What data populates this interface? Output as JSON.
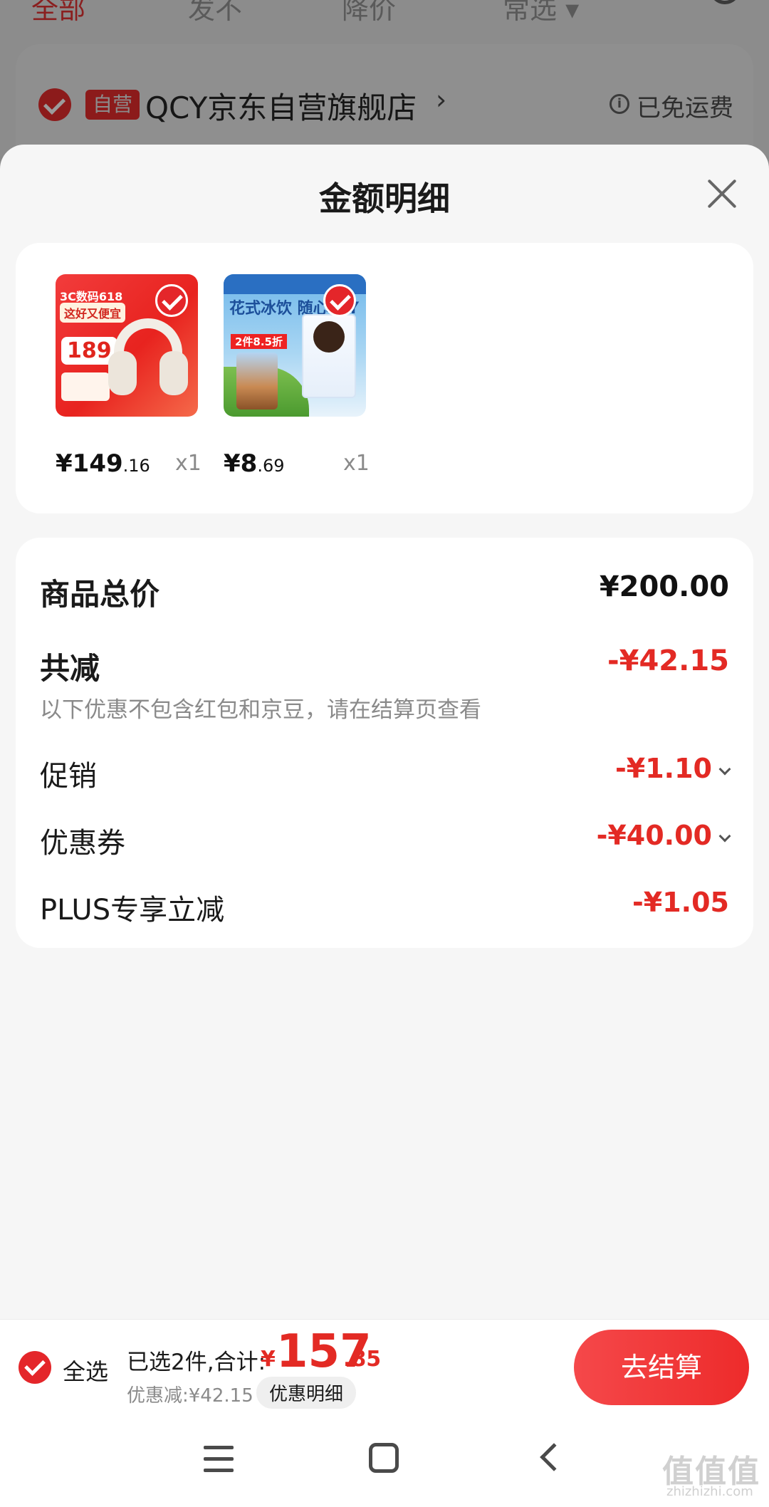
{
  "background": {
    "tabs": [
      "全部",
      "发不",
      "降价",
      "常选 ▾"
    ],
    "store_badge": "自营",
    "store_name": "QCY京东自营旗舰店",
    "free_shipping": "已免运费"
  },
  "sheet": {
    "title": "金额明细"
  },
  "products": [
    {
      "price_int": "¥149",
      "price_dec": ".16",
      "qty": "x1",
      "image_tag": "3C数码618",
      "image_chip": "这好又便宜",
      "image_price": "189"
    },
    {
      "price_int": "¥8",
      "price_dec": ".69",
      "qty": "x1",
      "image_text": "花式冰饮 随心DIY",
      "image_badge": "2件8.5折"
    }
  ],
  "summary": {
    "total_label": "商品总价",
    "total_value": "¥200.00",
    "reduce_label": "共减",
    "reduce_value": "-¥42.15",
    "note": "以下优惠不包含红包和京豆，请在结算页查看",
    "rows": [
      {
        "label": "促销",
        "value": "-¥1.10"
      },
      {
        "label": "优惠券",
        "value": "-¥40.00"
      },
      {
        "label": "PLUS专享立减",
        "value": "-¥1.05"
      }
    ]
  },
  "bottom": {
    "select_all": "全选",
    "selected_text": "已选2件,合计:",
    "currency": "¥",
    "total_int": "157",
    "total_dec": ".85",
    "discount_text": "优惠减:¥42.15",
    "detail_button": "优惠明细",
    "checkout_button": "去结算"
  },
  "watermark": {
    "main": "值值值",
    "sub": "zhizhizhi.com"
  },
  "colors": {
    "accent_red": "#e32a24",
    "checkout_gradient_start": "#f5484a",
    "checkout_gradient_end": "#ed2b2b"
  }
}
